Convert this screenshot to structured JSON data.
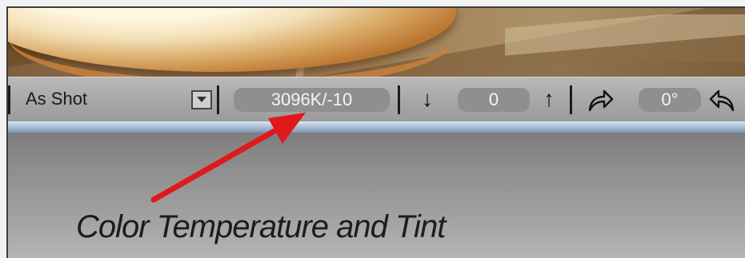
{
  "toolbar": {
    "white_balance_preset": "As Shot",
    "temperature_tint_value": "3096K/-10",
    "straighten_value": "0",
    "rotation_value": "0°"
  },
  "annotation": {
    "caption": "Color Temperature and Tint",
    "arrow_color": "#e0191c"
  },
  "icons": {
    "dropdown": "chevron-down-icon",
    "tint_down": "arrow-down-icon",
    "tint_up": "arrow-up-icon",
    "rotate_right": "rotate-right-icon",
    "rotate_left": "rotate-left-icon"
  }
}
